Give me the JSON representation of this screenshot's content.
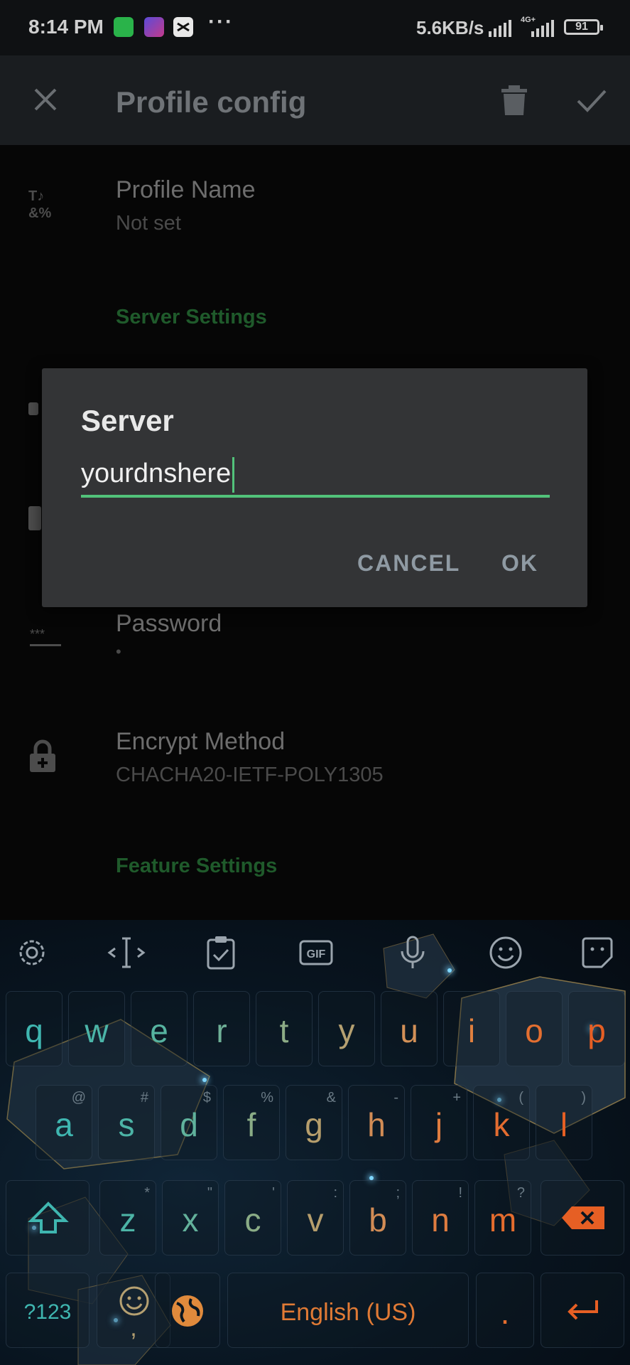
{
  "status_bar": {
    "time": "8:14 PM",
    "more": "···",
    "speed": "5.6KB/s",
    "network": "4G+",
    "battery": "91"
  },
  "app_bar": {
    "title": "Profile config"
  },
  "list": {
    "profile_name": {
      "title": "Profile Name",
      "value": "Not set"
    },
    "server_section": "Server Settings",
    "password": {
      "title": "Password",
      "value": "•"
    },
    "encrypt_method": {
      "title": "Encrypt Method",
      "value": "CHACHA20-IETF-POLY1305"
    },
    "feature_section": "Feature Settings"
  },
  "dialog": {
    "title": "Server",
    "input_value": "yourdnshere",
    "cancel_label": "CANCEL",
    "ok_label": "OK"
  },
  "keyboard": {
    "toolbar_icons": [
      "settings-icon",
      "cursor-icon",
      "clipboard-icon",
      "gif-icon",
      "microphone-icon",
      "emoji-icon",
      "sticker-icon"
    ],
    "gif_label": "GIF",
    "row1": [
      {
        "k": "q",
        "c": "#3fb6b0"
      },
      {
        "k": "w",
        "c": "#4bb5a8"
      },
      {
        "k": "e",
        "c": "#56b3a0"
      },
      {
        "k": "r",
        "c": "#6fb097"
      },
      {
        "k": "t",
        "c": "#8dac86"
      },
      {
        "k": "y",
        "c": "#b5a071"
      },
      {
        "k": "u",
        "c": "#d39057"
      },
      {
        "k": "i",
        "c": "#e0803f"
      },
      {
        "k": "o",
        "c": "#e46f30"
      },
      {
        "k": "p",
        "c": "#e65f24"
      }
    ],
    "row2": [
      {
        "k": "a",
        "c": "#3fb6b0",
        "h": "@"
      },
      {
        "k": "s",
        "c": "#4cb4a6",
        "h": "#"
      },
      {
        "k": "d",
        "c": "#60b29c",
        "h": "$"
      },
      {
        "k": "f",
        "c": "#8aac86",
        "h": "%"
      },
      {
        "k": "g",
        "c": "#b69e6c",
        "h": "&"
      },
      {
        "k": "h",
        "c": "#d28c55",
        "h": "-"
      },
      {
        "k": "j",
        "c": "#df7c40",
        "h": "+"
      },
      {
        "k": "k",
        "c": "#e36c30",
        "h": "("
      },
      {
        "k": "l",
        "c": "#e65f24",
        "h": ")"
      }
    ],
    "row3": [
      {
        "k": "z",
        "c": "#4cb4a6",
        "h": "*"
      },
      {
        "k": "x",
        "c": "#63b19b",
        "h": "\""
      },
      {
        "k": "c",
        "c": "#8aac86",
        "h": "'"
      },
      {
        "k": "v",
        "c": "#b69e6c",
        "h": ":"
      },
      {
        "k": "b",
        "c": "#d28c55",
        "h": ";"
      },
      {
        "k": "n",
        "c": "#df7c40",
        "h": "!"
      },
      {
        "k": "m",
        "c": "#e46c2e",
        "h": "?"
      }
    ],
    "symbols_label": "?123",
    "comma_label": ",",
    "space_label": "English (US)",
    "period_label": "."
  }
}
